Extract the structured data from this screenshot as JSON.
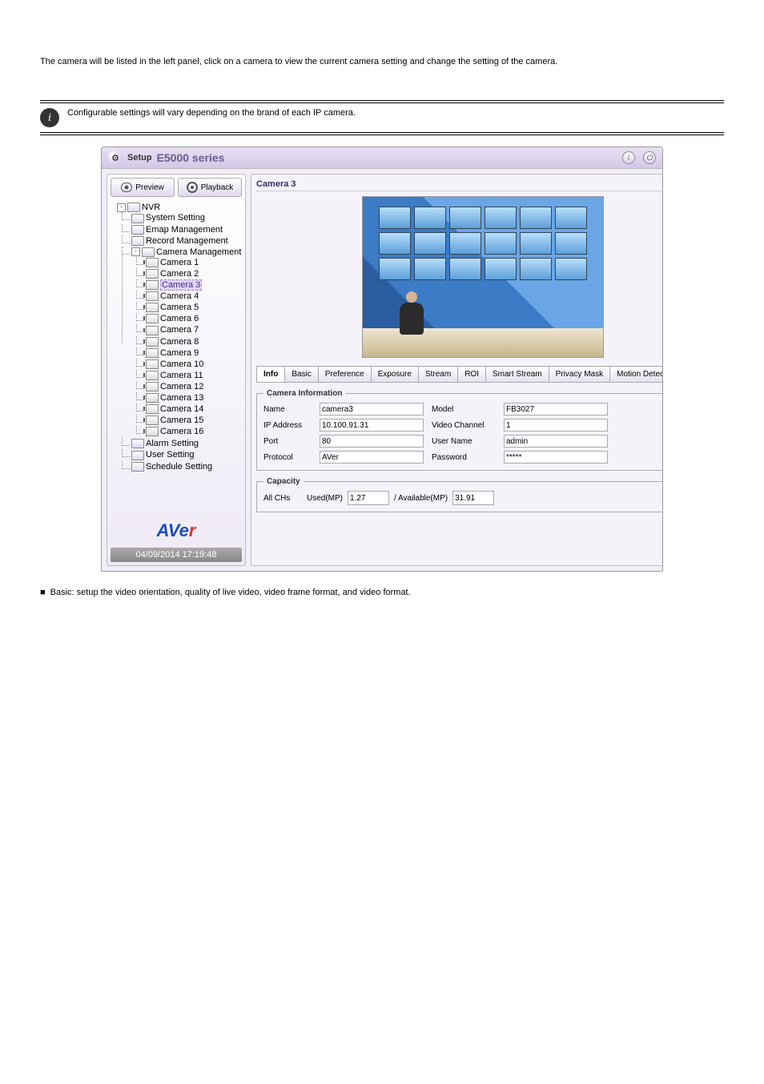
{
  "instruction_text": "The camera will be listed in the left panel, click on a camera to view the current camera setting and change the setting of the camera.",
  "tip_text": "Configurable settings will vary depending on the brand of each IP camera.",
  "bullet_text": "Basic: setup the video orientation, quality of live video, video frame format, and video format.",
  "topbar": {
    "setup": "Setup",
    "series": "E5000 series"
  },
  "nav": {
    "preview": "Preview",
    "playback": "Playback"
  },
  "tree": {
    "root": "NVR",
    "nodes": [
      "System Setting",
      "Emap Management",
      "Record Management",
      "Camera Management"
    ],
    "cameras": [
      "Camera 1",
      "Camera 2",
      "Camera 3",
      "Camera 4",
      "Camera 5",
      "Camera 6",
      "Camera 7",
      "Camera 8",
      "Camera 9",
      "Camera 10",
      "Camera 11",
      "Camera 12",
      "Camera 13",
      "Camera 14",
      "Camera 15",
      "Camera 16"
    ],
    "bottom": [
      "Alarm Setting",
      "User Setting",
      "Schedule Setting"
    ],
    "selected_index": 2
  },
  "logo": "AVer",
  "datetime": "04/09/2014 17:19:48",
  "main": {
    "title": "Camera 3",
    "tabs": [
      {
        "label": "Info",
        "active": true
      },
      {
        "label": "Basic"
      },
      {
        "label": "Preference"
      },
      {
        "label": "Exposure"
      },
      {
        "label": "Stream"
      },
      {
        "label": "ROI"
      },
      {
        "label": "Smart Stream"
      },
      {
        "label": "Privacy Mask"
      },
      {
        "label": "Motion Detection"
      }
    ],
    "camera_info": {
      "legend": "Camera Information",
      "name_label": "Name",
      "name": "camera3",
      "ip_label": "IP Address",
      "ip": "10.100.91.31",
      "port_label": "Port",
      "port": "80",
      "protocol_label": "Protocol",
      "protocol": "AVer",
      "model_label": "Model",
      "model": "FB3027",
      "channel_label": "Video Channel",
      "channel": "1",
      "user_label": "User Name",
      "user": "admin",
      "pass_label": "Password",
      "pass": "*****"
    },
    "capacity": {
      "legend": "Capacity",
      "all": "All CHs",
      "used_label": "Used(MP)",
      "used": "1.27",
      "avail_label": "/ Available(MP)",
      "avail": "31.91"
    }
  }
}
